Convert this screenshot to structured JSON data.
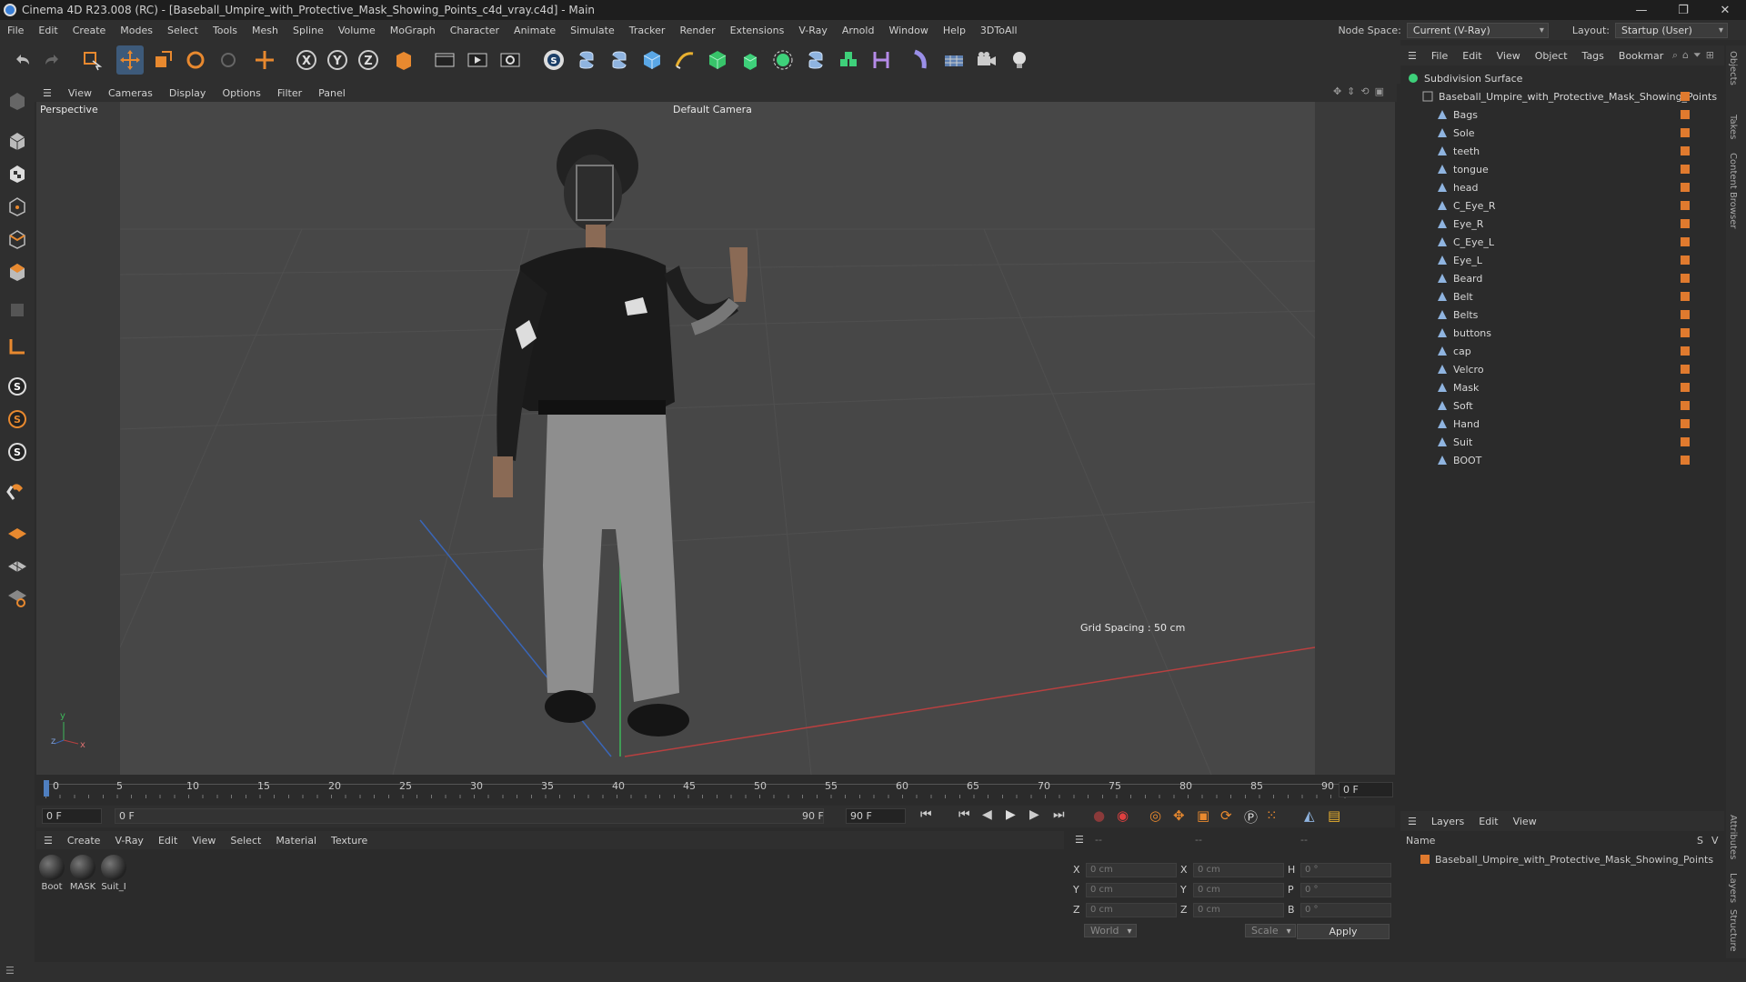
{
  "titlebar": {
    "title": "Cinema 4D R23.008 (RC) - [Baseball_Umpire_with_Protective_Mask_Showing_Points_c4d_vray.c4d] - Main",
    "min": "—",
    "max": "❐",
    "close": "✕"
  },
  "menu": [
    "File",
    "Edit",
    "Create",
    "Modes",
    "Select",
    "Tools",
    "Mesh",
    "Spline",
    "Volume",
    "MoGraph",
    "Character",
    "Animate",
    "Simulate",
    "Tracker",
    "Render",
    "Extensions",
    "V-Ray",
    "Arnold",
    "Window",
    "Help",
    "3DToAll"
  ],
  "nodespace": {
    "label": "Node Space:",
    "value": "Current (V-Ray)"
  },
  "layout": {
    "label": "Layout:",
    "value": "Startup (User)"
  },
  "viewport": {
    "menu": [
      "View",
      "Cameras",
      "Display",
      "Options",
      "Filter",
      "Panel"
    ],
    "name": "Perspective",
    "camera": "Default Camera",
    "grid": "Grid Spacing : 50 cm",
    "axis_y": "y",
    "axis_z": "z",
    "axis_x": "x"
  },
  "timeline": {
    "ticks": [
      "0",
      "5",
      "10",
      "15",
      "20",
      "25",
      "30",
      "35",
      "40",
      "45",
      "50",
      "55",
      "60",
      "65",
      "70",
      "75",
      "80",
      "85",
      "90"
    ],
    "current_frame": "0 F",
    "start": "0 F",
    "range_start": "0 F",
    "range_end": "90 F",
    "end": "90 F"
  },
  "material": {
    "menu": [
      "Create",
      "V-Ray",
      "Edit",
      "View",
      "Select",
      "Material",
      "Texture"
    ],
    "items": [
      "Boot",
      "MASK",
      "Suit_I"
    ]
  },
  "coords": {
    "dash1": "--",
    "dash2": "--",
    "dash3": "--",
    "rows": [
      {
        "a": "X",
        "av": "0 cm",
        "b": "X",
        "bv": "0 cm",
        "c": "H",
        "cv": "0 °"
      },
      {
        "a": "Y",
        "av": "0 cm",
        "b": "Y",
        "bv": "0 cm",
        "c": "P",
        "cv": "0 °"
      },
      {
        "a": "Z",
        "av": "0 cm",
        "b": "Z",
        "bv": "0 cm",
        "c": "B",
        "cv": "0 °"
      }
    ],
    "world": "World",
    "scale": "Scale",
    "apply": "Apply"
  },
  "objects": {
    "menu": [
      "File",
      "Edit",
      "View",
      "Object",
      "Tags",
      "Bookmar"
    ],
    "root": "Subdivision Surface",
    "parent": "Baseball_Umpire_with_Protective_Mask_Showing_Points",
    "children": [
      "Bags",
      "Sole",
      "teeth",
      "tongue",
      "head",
      "C_Eye_R",
      "Eye_R",
      "C_Eye_L",
      "Eye_L",
      "Beard",
      "Belt",
      "Belts",
      "buttons",
      "cap",
      "Velcro",
      "Mask",
      "Soft",
      "Hand",
      "Suit",
      "BOOT"
    ]
  },
  "layers": {
    "menu": [
      "Layers",
      "Edit",
      "View"
    ],
    "col_name": "Name",
    "col_s": "S",
    "col_v": "V",
    "item": "Baseball_Umpire_with_Protective_Mask_Showing_Points"
  },
  "sidetabs": [
    "Objects",
    "Takes",
    "Content Browser",
    "Attributes",
    "Layers",
    "Structure"
  ],
  "colors": {
    "tag": "#e07a2e",
    "accent": "#3a7fd6"
  }
}
